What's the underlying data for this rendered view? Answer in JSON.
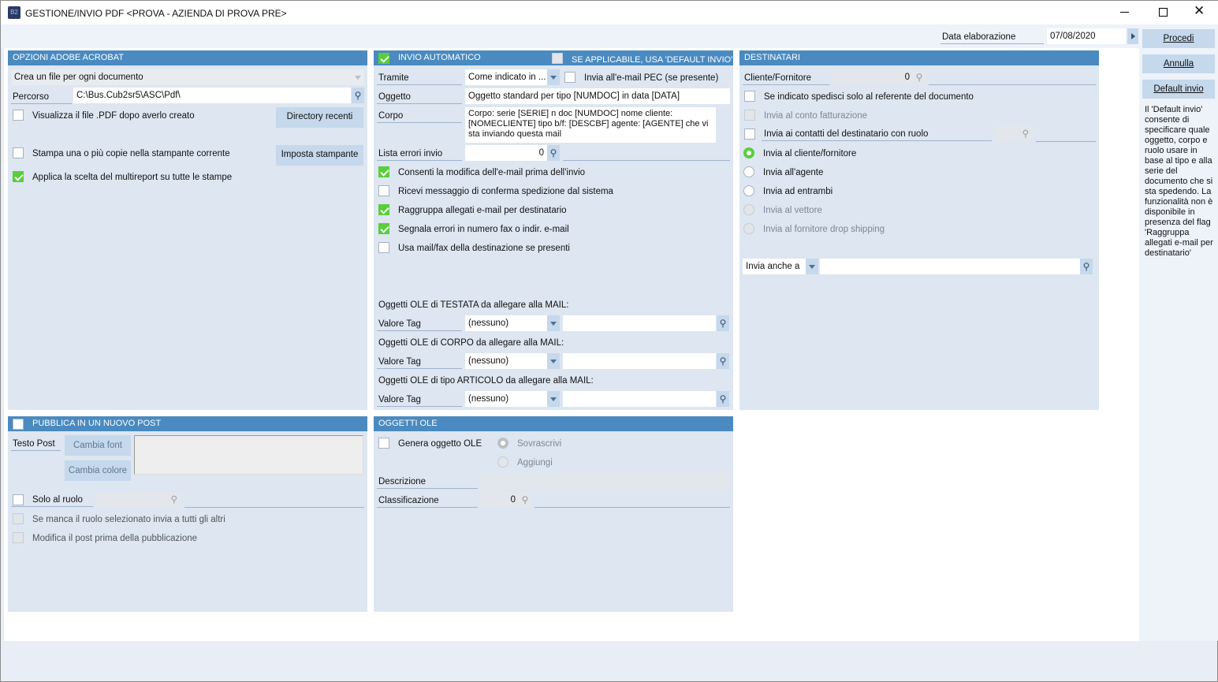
{
  "window": {
    "title": "GESTIONE/INVIO PDF <PROVA - AZIENDA DI PROVA PRE>",
    "app_icon": "B2"
  },
  "header": {
    "date_label": "Data elaborazione",
    "date_value": "07/08/2020"
  },
  "actions": {
    "procedi": "Procedi",
    "annulla": "Annulla",
    "default_invio": "Default invio",
    "help_text": "Il 'Default invio' consente di specificare quale oggetto, corpo e ruolo usare in base al tipo e alla serie del documento che si sta spedendo. La funzionalità non è disponibile in presenza del flag 'Raggruppa allegati e-mail per destinatario'"
  },
  "acrobat": {
    "title": "OPZIONI ADOBE ACROBAT",
    "mode": "Crea un file per ogni documento",
    "path_label": "Percorso",
    "path_value": "C:\\Bus.Cub2sr5\\ASC\\Pdf\\",
    "view_pdf": "Visualizza il file .PDF dopo averlo creato",
    "view_pdf_checked": false,
    "recent_dirs": "Directory recenti",
    "print_copies": "Stampa una o più copie nella stampante corrente",
    "print_copies_checked": false,
    "set_printer": "Imposta stampante",
    "multireport": "Applica la scelta del multireport su tutte le stampe",
    "multireport_checked": true
  },
  "invio": {
    "title": "INVIO AUTOMATICO",
    "checked": true,
    "default_title": "SE APPLICABILE, USA 'DEFAULT INVIO'",
    "default_checked": false,
    "tramite_label": "Tramite",
    "tramite_value": "Come indicato in ...",
    "pec": "Invia all'e-mail PEC (se presente)",
    "pec_checked": false,
    "oggetto_label": "Oggetto",
    "oggetto_value": "Oggetto standard per tipo [NUMDOC] in data [DATA]",
    "corpo_label": "Corpo",
    "corpo_value": "Corpo: serie [SERIE] n doc [NUMDOC] nome cliente: [NOMECLIENTE] tipo b/f: [DESCBF] agente: [AGENTE] che vi sta inviando questa mail",
    "errori_label": "Lista errori invio",
    "errori_value": "0",
    "options": [
      {
        "label": "Consenti la modifica dell'e-mail prima dell'invio",
        "checked": true
      },
      {
        "label": "Ricevi messaggio di conferma spedizione dal sistema",
        "checked": false
      },
      {
        "label": "Raggruppa allegati e-mail per destinatario",
        "checked": true
      },
      {
        "label": "Segnala errori in numero fax o indir. e-mail",
        "checked": true
      },
      {
        "label": "Usa mail/fax della destinazione se presenti",
        "checked": false
      }
    ],
    "ole_groups": [
      {
        "title": "Oggetti OLE di TESTATA da allegare alla MAIL:",
        "tag_label": "Valore Tag",
        "tag_value": "(nessuno)",
        "text": ""
      },
      {
        "title": "Oggetti OLE di CORPO da allegare alla MAIL:",
        "tag_label": "Valore Tag",
        "tag_value": "(nessuno)",
        "text": ""
      },
      {
        "title": "Oggetti OLE di tipo ARTICOLO da allegare alla MAIL:",
        "tag_label": "Valore Tag",
        "tag_value": "(nessuno)",
        "text": ""
      }
    ]
  },
  "destinatari": {
    "title": "DESTINATARI",
    "cf_label": "Cliente/Fornitore",
    "cf_value": "0",
    "referente": "Se indicato spedisci solo al referente del documento",
    "conto": "Invia al conto fatturazione",
    "contatti": "Invia ai contatti del destinatario con ruolo",
    "radios": [
      {
        "label": "Invia al cliente/fornitore",
        "selected": true,
        "enabled": true
      },
      {
        "label": "Invia all'agente",
        "selected": false,
        "enabled": true
      },
      {
        "label": "Invia ad entrambi",
        "selected": false,
        "enabled": true
      },
      {
        "label": "Invia al vettore",
        "selected": false,
        "enabled": false
      },
      {
        "label": "Invia al fornitore drop shipping",
        "selected": false,
        "enabled": false
      }
    ],
    "anche_label": "Invia anche a",
    "anche_value": ""
  },
  "post": {
    "title": "PUBBLICA IN UN NUOVO POST",
    "checked": false,
    "testo_label": "Testo Post",
    "cambia_font": "Cambia font",
    "cambia_colore": "Cambia colore",
    "solo_ruolo": "Solo al ruolo",
    "manca_ruolo": "Se manca il ruolo selezionato invia a tutti gli altri",
    "modifica_post": "Modifica il post prima della pubblicazione"
  },
  "ole": {
    "title": "OGGETTI OLE",
    "genera": "Genera oggetto OLE",
    "sovrascrivi": "Sovrascrivi",
    "aggiungi": "Aggiungi",
    "descrizione_label": "Descrizione",
    "classificazione_label": "Classificazione",
    "classificazione_value": "0"
  }
}
